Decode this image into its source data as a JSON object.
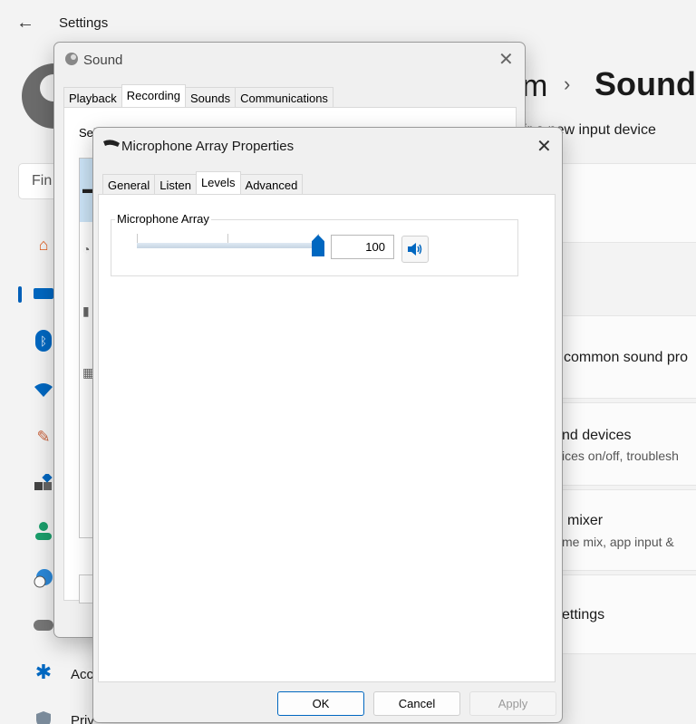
{
  "settings": {
    "back_icon": "back-arrow-icon",
    "title": "Settings",
    "search_placeholder": "Fin",
    "breadcrumb_fragment": "m",
    "breadcrumb_page": "Sound",
    "new_input_device": "ir a new input device",
    "common_sound": "common sound pro",
    "devices_title": "nd devices",
    "devices_desc": "ices on/off, troublesh",
    "mixer_title": "mixer",
    "mixer_desc": "me mix, app input &",
    "settings_title": "ettings",
    "nav_accessibility": "Acc",
    "nav_privacy": "Priv",
    "accent": "#005fb8"
  },
  "sound_dialog": {
    "title": "Sound",
    "close_icon": "close-icon",
    "tabs": [
      "Playback",
      "Recording",
      "Sounds",
      "Communications"
    ],
    "active_tab": "Recording",
    "select_fragment": "Sel"
  },
  "mic_dialog": {
    "title": "Microphone Array Properties",
    "tabs": [
      "General",
      "Listen",
      "Levels",
      "Advanced"
    ],
    "active_tab": "Levels",
    "group_label": "Microphone Array",
    "level_value": "100",
    "level_fraction": 1.0,
    "mute_icon": "speaker-icon",
    "buttons": {
      "ok": "OK",
      "cancel": "Cancel",
      "apply": "Apply"
    }
  }
}
